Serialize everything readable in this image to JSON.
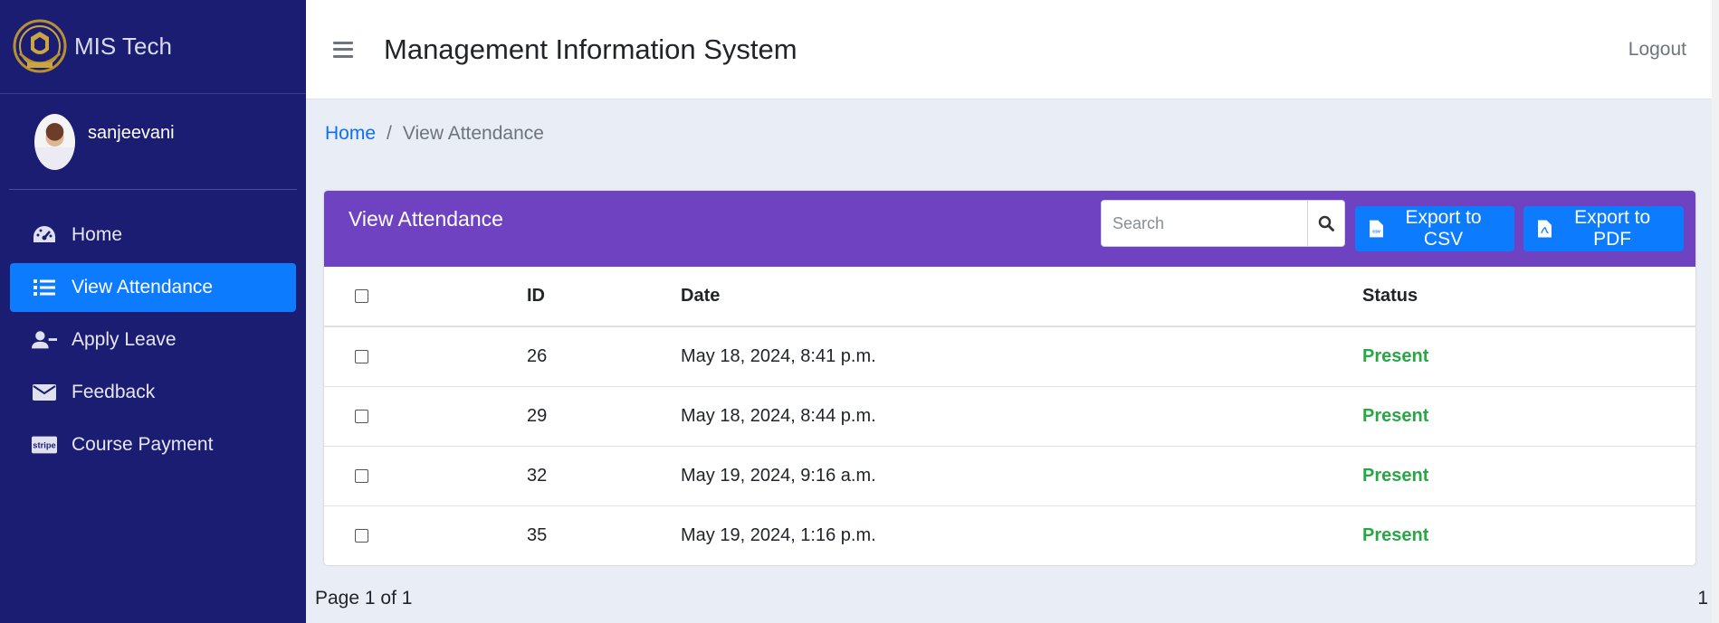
{
  "brand": {
    "name": "MIS Tech",
    "logo_icon": "college-crest-icon"
  },
  "user": {
    "name": "sanjeevani"
  },
  "sidebar": {
    "items": [
      {
        "label": "Home",
        "icon": "dashboard-icon",
        "active": false
      },
      {
        "label": "View Attendance",
        "icon": "list-icon",
        "active": true
      },
      {
        "label": "Apply Leave",
        "icon": "user-minus-icon",
        "active": false
      },
      {
        "label": "Feedback",
        "icon": "envelope-icon",
        "active": false
      },
      {
        "label": "Course Payment",
        "icon": "stripe-icon",
        "active": false
      }
    ]
  },
  "header": {
    "title": "Management Information System",
    "logout_label": "Logout"
  },
  "breadcrumb": {
    "home": "Home",
    "separator": "/",
    "current": "View Attendance"
  },
  "card": {
    "title": "View Attendance",
    "search_placeholder": "Search",
    "export_csv_label": "Export to CSV",
    "export_pdf_label": "Export to PDF",
    "accent_color": "#6f42c1",
    "button_color": "#0d7bfd"
  },
  "table": {
    "columns": [
      "ID",
      "Date",
      "Status"
    ],
    "rows": [
      {
        "id": "26",
        "date": "May 18, 2024, 8:41 p.m.",
        "status": "Present"
      },
      {
        "id": "29",
        "date": "May 18, 2024, 8:44 p.m.",
        "status": "Present"
      },
      {
        "id": "32",
        "date": "May 19, 2024, 9:16 a.m.",
        "status": "Present"
      },
      {
        "id": "35",
        "date": "May 19, 2024, 1:16 p.m.",
        "status": "Present"
      }
    ]
  },
  "pagination": {
    "summary": "Page 1 of 1",
    "current_page": "1"
  }
}
